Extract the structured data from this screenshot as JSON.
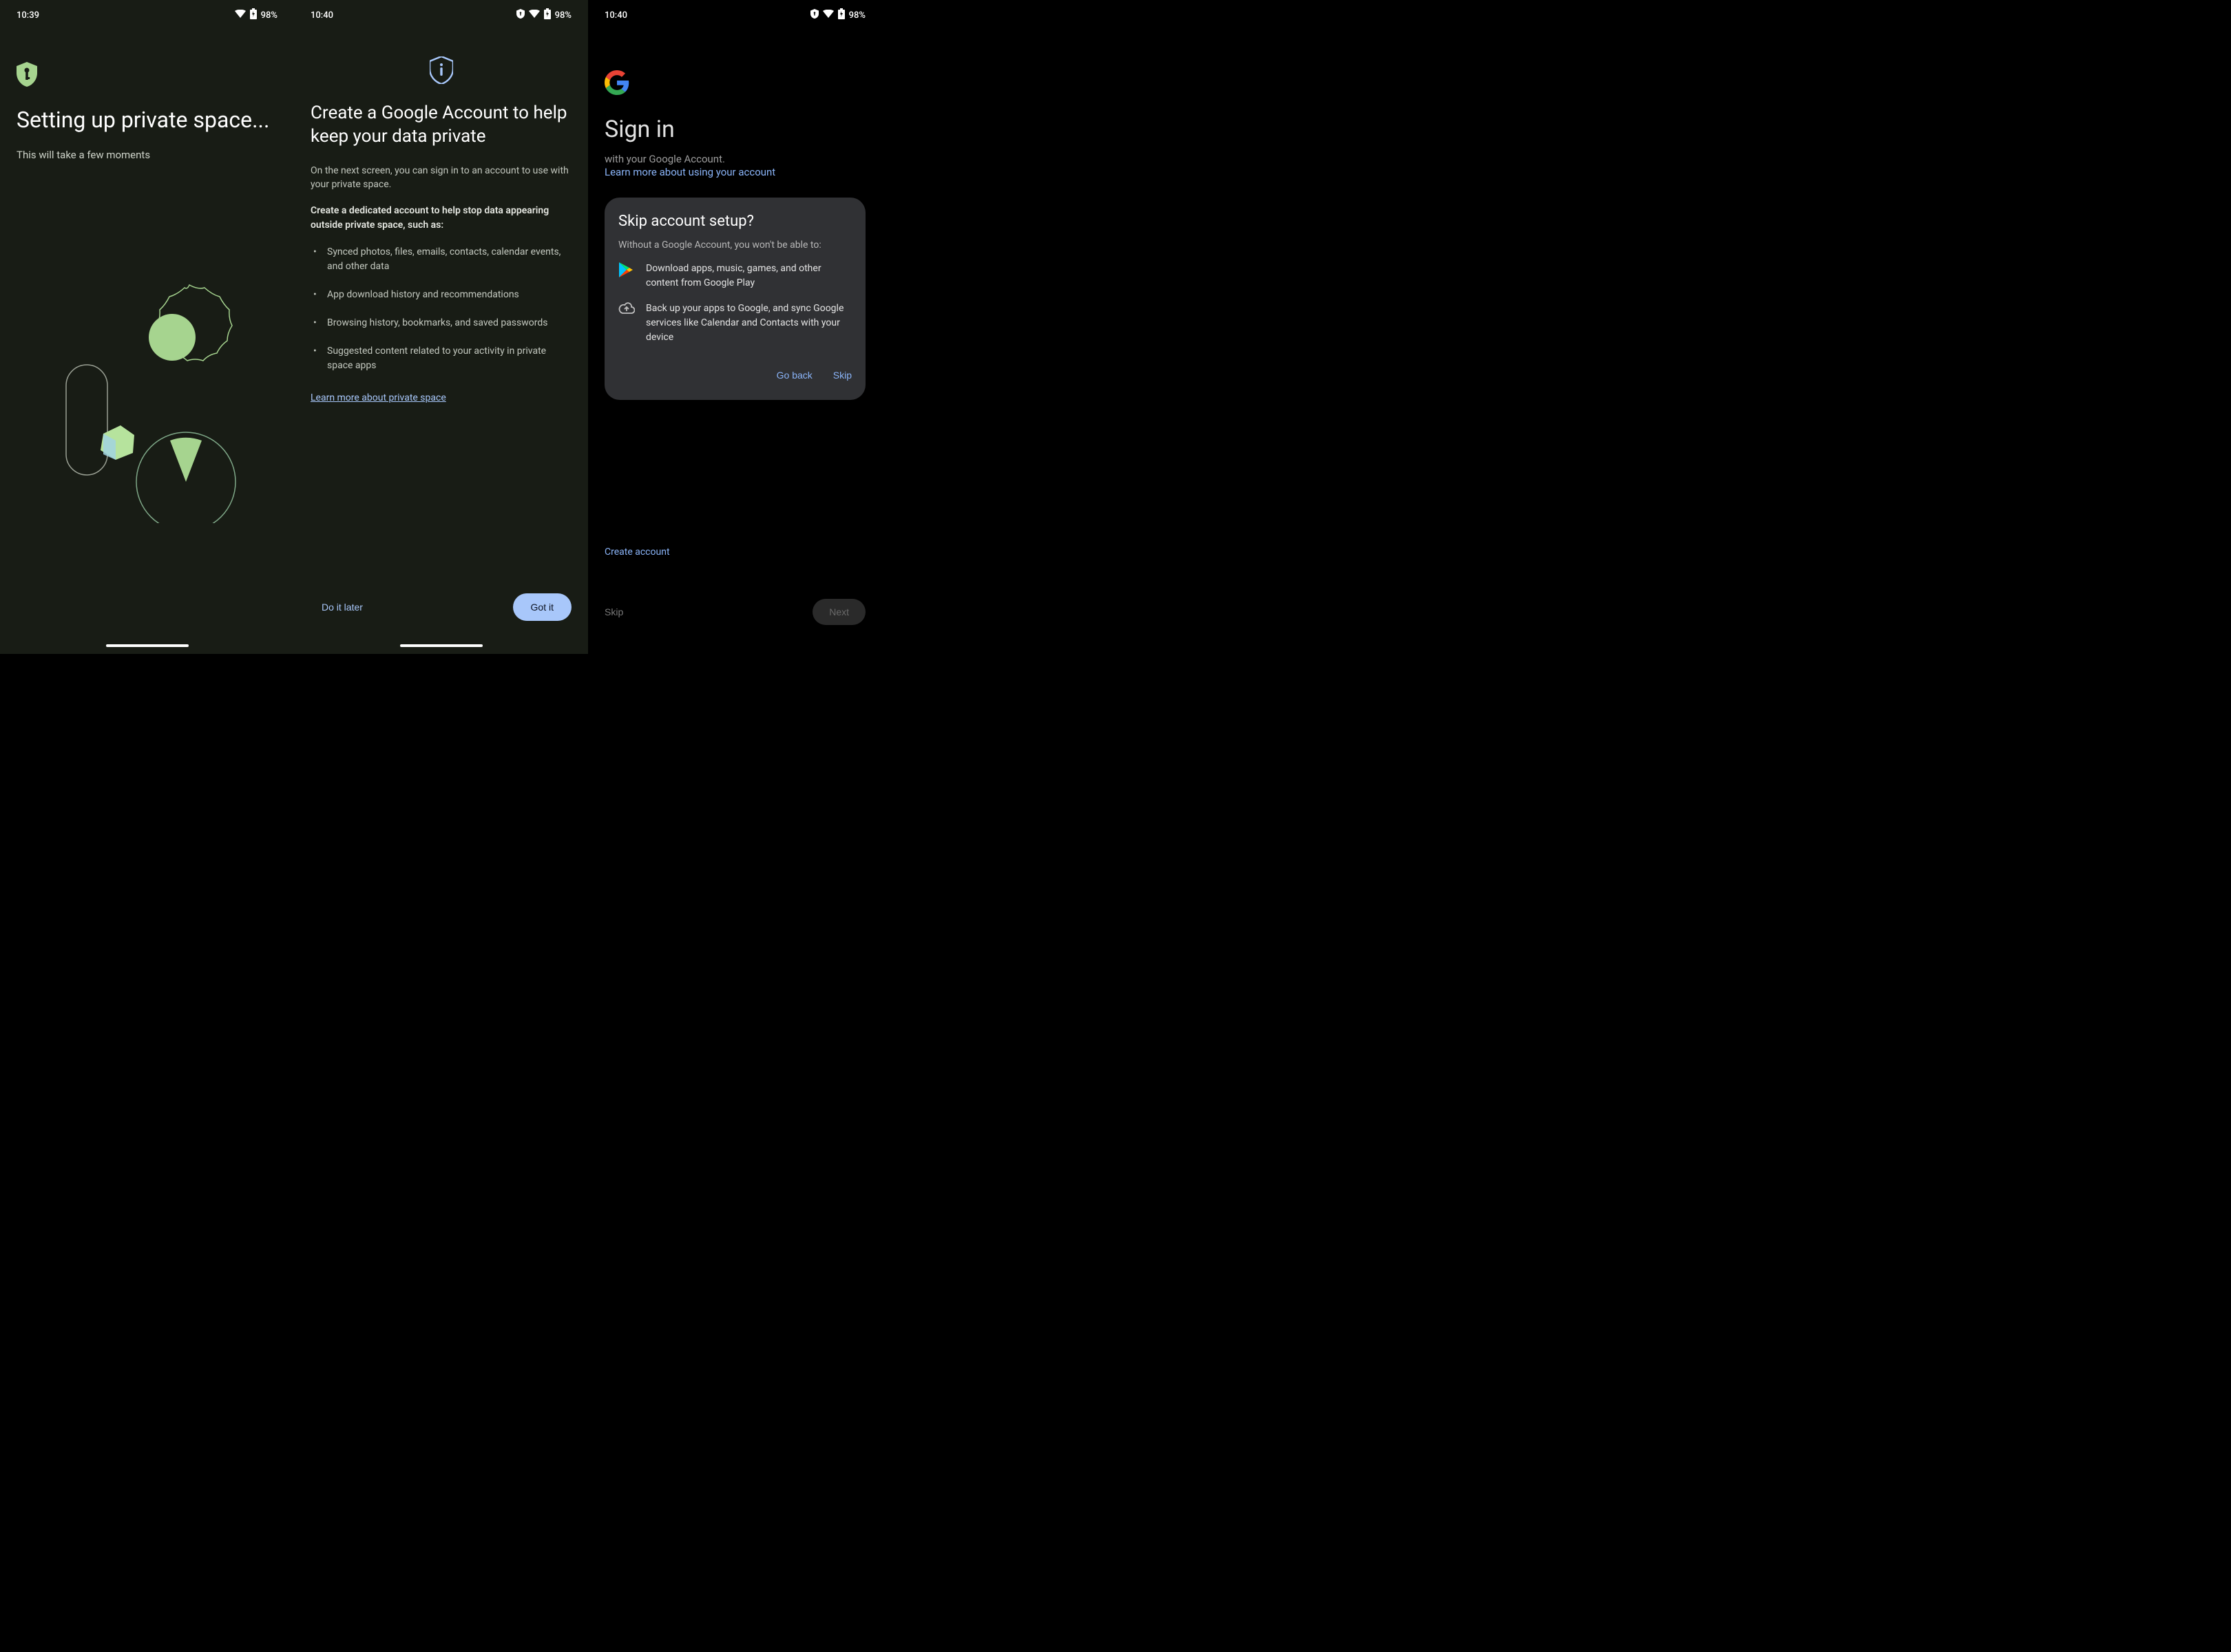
{
  "screen1": {
    "status": {
      "time": "10:39",
      "battery": "98%"
    },
    "title": "Setting up private space...",
    "subtitle": "This will take a few moments"
  },
  "screen2": {
    "status": {
      "time": "10:40",
      "battery": "98%"
    },
    "title": "Create a Google Account to help keep your data private",
    "description": "On the next screen, you can sign in to an account to use with your private space.",
    "bold_intro": "Create a dedicated account to help stop data appearing outside private space, such as:",
    "bullets": [
      "Synced photos, files, emails, contacts, calendar events, and other data",
      "App download history and recommendations",
      "Browsing history, bookmarks, and saved passwords",
      "Suggested content related to your activity in private space apps"
    ],
    "learn_more": "Learn more about private space",
    "do_it_later": "Do it later",
    "got_it": "Got it"
  },
  "screen3": {
    "status": {
      "time": "10:40",
      "battery": "98%"
    },
    "title": "Sign in",
    "subtitle": "with your Google Account.",
    "learn_more": "Learn more about using your account",
    "modal": {
      "title": "Skip account setup?",
      "subtitle": "Without a Google Account, you won't be able to:",
      "items": [
        {
          "text": "Download apps, music, games, and other content from Google Play"
        },
        {
          "text": "Back up your apps to Google, and sync Google services like Calendar and Contacts with your device"
        }
      ],
      "go_back": "Go back",
      "skip": "Skip"
    },
    "create_account": "Create account",
    "skip_bottom": "Skip",
    "next": "Next"
  }
}
